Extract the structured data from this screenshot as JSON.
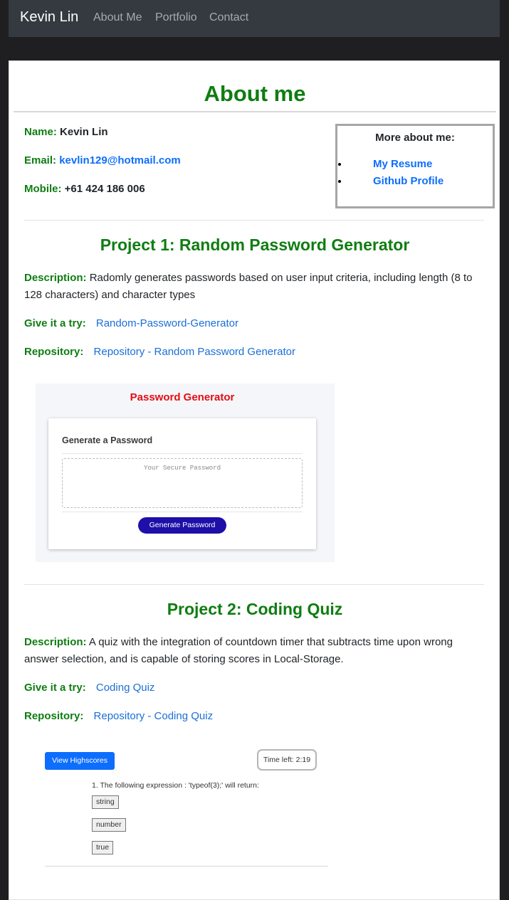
{
  "navbar": {
    "brand": "Kevin Lin",
    "links": [
      "About Me",
      "Portfolio",
      "Contact"
    ]
  },
  "about": {
    "title": "About me",
    "name_label": "Name:",
    "name": "Kevin Lin",
    "email_label": "Email:",
    "email": "kevlin129@hotmail.com",
    "mobile_label": "Mobile:",
    "mobile": "+61 424 186 006",
    "more": {
      "title": "More about me:",
      "links": [
        "My Resume",
        "Github Profile"
      ]
    }
  },
  "projects": [
    {
      "title": "Project 1: Random Password Generator",
      "description_label": "Description:",
      "description": "Radomly generates passwords based on user input criteria, including length (8 to 128 characters) and character types",
      "try_label": "Give it a try:",
      "try_link": "Random-Password-Generator",
      "repo_label": "Repository:",
      "repo_link": "Repository - Random Password Generator",
      "screenshot": {
        "title": "Password Generator",
        "card_title": "Generate a Password",
        "placeholder": "Your Secure Password",
        "button": "Generate Password"
      }
    },
    {
      "title": "Project 2: Coding Quiz",
      "description_label": "Description:",
      "description": "A quiz with the integration of countdown timer that subtracts time upon wrong answer selection, and is capable of storing scores in Local-Storage.",
      "try_label": "Give it a try:",
      "try_link": "Coding Quiz",
      "repo_label": "Repository:",
      "repo_link": "Repository - Coding Quiz",
      "screenshot": {
        "highscores_button": "View Highscores",
        "timer": "Time left: 2:19",
        "question": "1. The following expression : 'typeof(3);' will return:",
        "answers": [
          "string",
          "number",
          "true"
        ]
      }
    }
  ],
  "colors": {
    "heading_green": "#0f7d12",
    "link_blue": "#0d6efd",
    "navbar_bg": "#343a40",
    "page_bg": "#1f1f22"
  }
}
